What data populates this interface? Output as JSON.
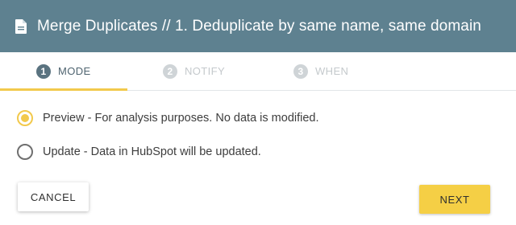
{
  "header": {
    "title": "Merge Duplicates // 1. Deduplicate by same name, same domain",
    "icon": "document-icon",
    "background": "#5e8190"
  },
  "stepper": {
    "steps": [
      {
        "number": "1",
        "label": "MODE",
        "active": true
      },
      {
        "number": "2",
        "label": "NOTIFY",
        "active": false
      },
      {
        "number": "3",
        "label": "WHEN",
        "active": false
      }
    ],
    "accent": "#f2c94c"
  },
  "mode_options": [
    {
      "label": "Preview - For analysis purposes. No data is modified.",
      "selected": true
    },
    {
      "label": "Update - Data in HubSpot will be updated.",
      "selected": false
    }
  ],
  "buttons": {
    "cancel_label": "CANCEL",
    "next_label": "NEXT"
  }
}
